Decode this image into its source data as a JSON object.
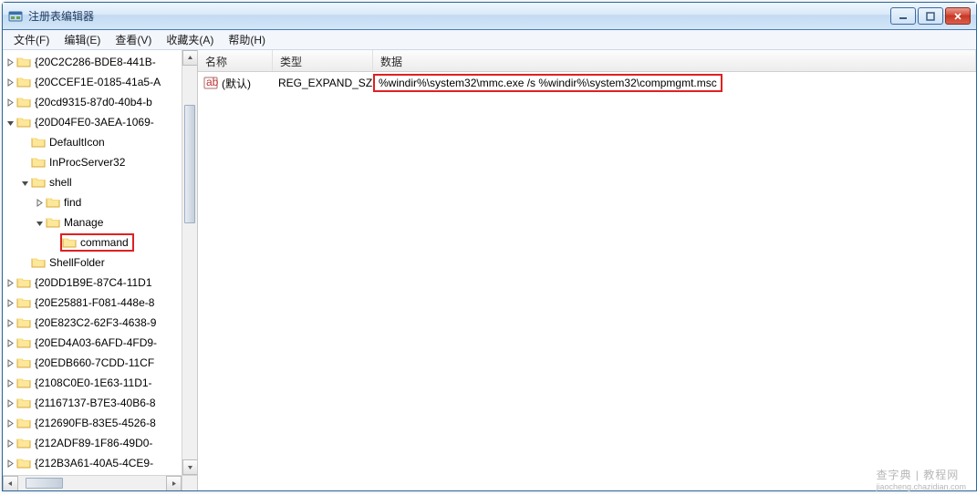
{
  "window": {
    "title": "注册表编辑器"
  },
  "menu": {
    "file": "文件(F)",
    "edit": "编辑(E)",
    "view": "查看(V)",
    "favorites": "收藏夹(A)",
    "help": "帮助(H)"
  },
  "tree": [
    {
      "depth": 0,
      "expander": "closed",
      "label": "{20C2C286-BDE8-441B-"
    },
    {
      "depth": 0,
      "expander": "closed",
      "label": "{20CCEF1E-0185-41a5-A"
    },
    {
      "depth": 0,
      "expander": "closed",
      "label": "{20cd9315-87d0-40b4-b"
    },
    {
      "depth": 0,
      "expander": "open",
      "label": "{20D04FE0-3AEA-1069-"
    },
    {
      "depth": 1,
      "expander": "none",
      "label": "DefaultIcon"
    },
    {
      "depth": 1,
      "expander": "none",
      "label": "InProcServer32"
    },
    {
      "depth": 1,
      "expander": "open",
      "label": "shell"
    },
    {
      "depth": 2,
      "expander": "closed",
      "label": "find"
    },
    {
      "depth": 2,
      "expander": "open",
      "label": "Manage"
    },
    {
      "depth": 3,
      "expander": "none",
      "label": "command",
      "highlight": true
    },
    {
      "depth": 1,
      "expander": "none",
      "label": "ShellFolder"
    },
    {
      "depth": 0,
      "expander": "closed",
      "label": "{20DD1B9E-87C4-11D1"
    },
    {
      "depth": 0,
      "expander": "closed",
      "label": "{20E25881-F081-448e-8"
    },
    {
      "depth": 0,
      "expander": "closed",
      "label": "{20E823C2-62F3-4638-9"
    },
    {
      "depth": 0,
      "expander": "closed",
      "label": "{20ED4A03-6AFD-4FD9-"
    },
    {
      "depth": 0,
      "expander": "closed",
      "label": "{20EDB660-7CDD-11CF"
    },
    {
      "depth": 0,
      "expander": "closed",
      "label": "{2108C0E0-1E63-11D1-"
    },
    {
      "depth": 0,
      "expander": "closed",
      "label": "{21167137-B7E3-40B6-8"
    },
    {
      "depth": 0,
      "expander": "closed",
      "label": "{212690FB-83E5-4526-8"
    },
    {
      "depth": 0,
      "expander": "closed",
      "label": "{212ADF89-1F86-49D0-"
    },
    {
      "depth": 0,
      "expander": "closed",
      "label": "{212B3A61-40A5-4CE9-"
    }
  ],
  "columns": {
    "name": "名称",
    "type": "类型",
    "data": "数据"
  },
  "rows": [
    {
      "name": "(默认)",
      "type": "REG_EXPAND_SZ",
      "data": "%windir%\\system32\\mmc.exe /s %windir%\\system32\\compmgmt.msc",
      "data_highlight": true
    }
  ],
  "watermark": {
    "main": "查字典 | 教程网",
    "sub": "jiaocheng.chazidian.com"
  }
}
